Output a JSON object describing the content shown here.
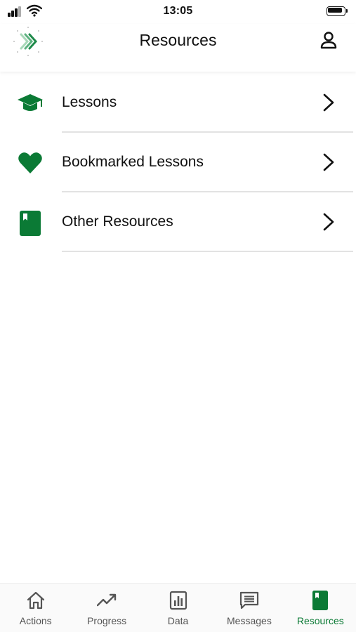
{
  "status_bar": {
    "time": "13:05"
  },
  "header": {
    "title": "Resources"
  },
  "list": {
    "items": [
      {
        "label": "Lessons",
        "icon": "graduation-cap-icon"
      },
      {
        "label": "Bookmarked Lessons",
        "icon": "heart-icon"
      },
      {
        "label": "Other Resources",
        "icon": "book-icon"
      }
    ]
  },
  "tabs": [
    {
      "label": "Actions",
      "icon": "home-icon",
      "active": false
    },
    {
      "label": "Progress",
      "icon": "trend-up-icon",
      "active": false
    },
    {
      "label": "Data",
      "icon": "bar-chart-icon",
      "active": false
    },
    {
      "label": "Messages",
      "icon": "message-icon",
      "active": false
    },
    {
      "label": "Resources",
      "icon": "book-icon",
      "active": true
    }
  ],
  "colors": {
    "accent": "#0b7a35",
    "inactive_tab": "#555555",
    "divider": "#e2e2e2",
    "text": "#111111"
  }
}
